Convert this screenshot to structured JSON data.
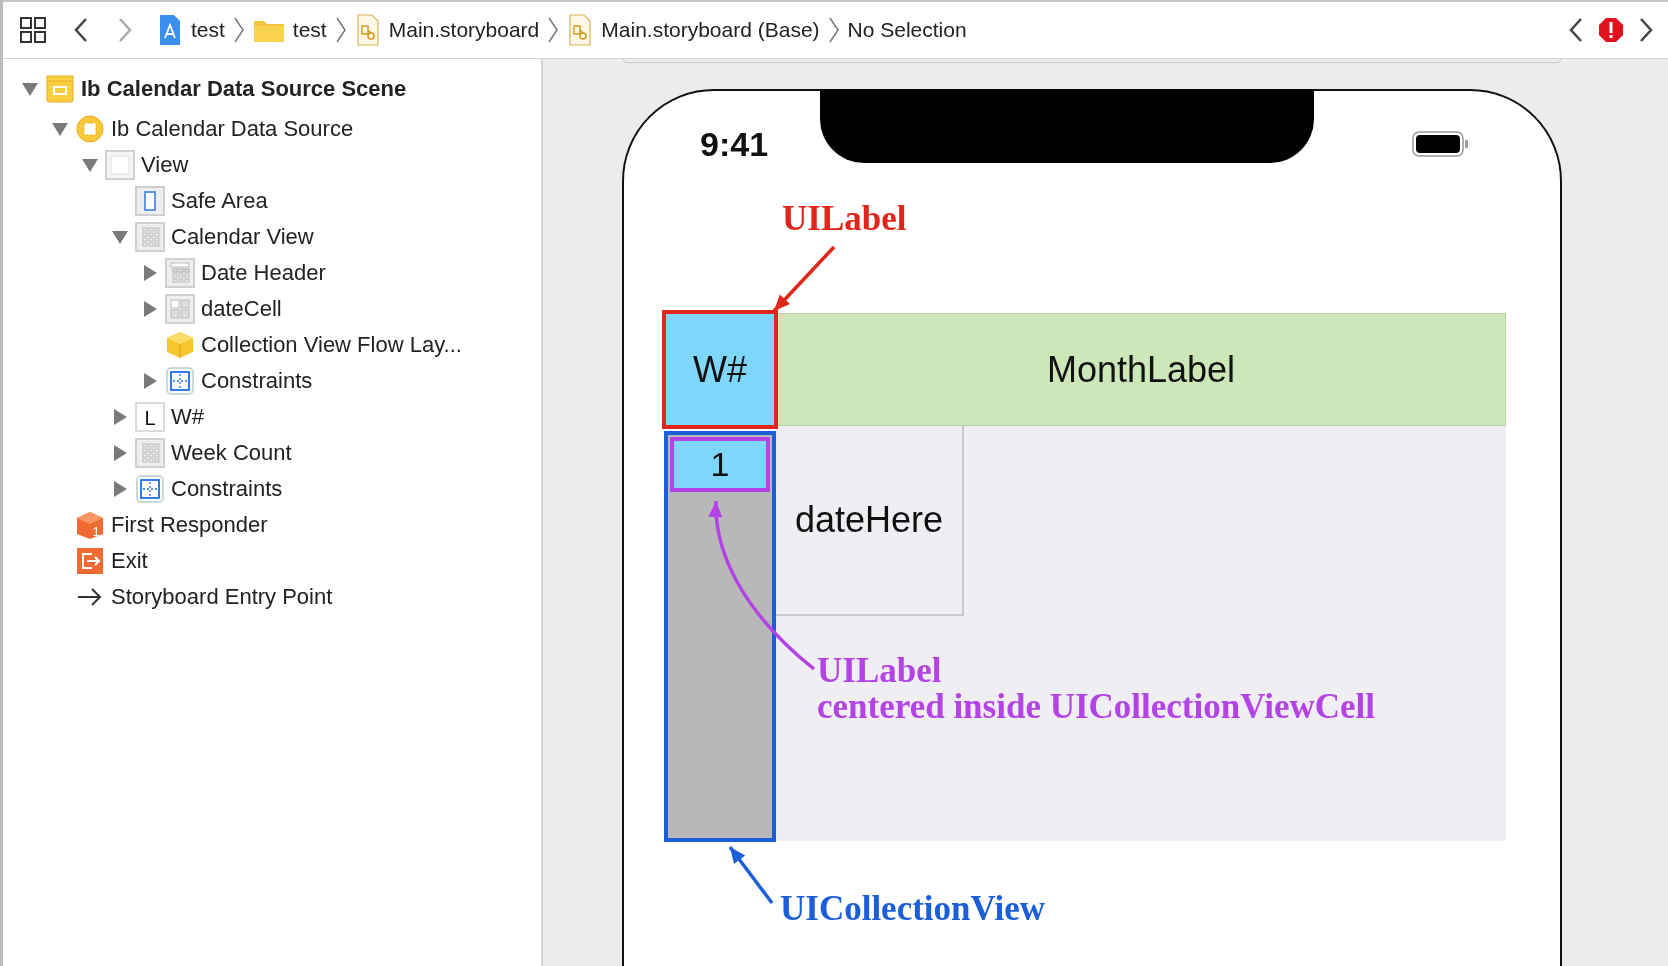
{
  "toolbar": {
    "breadcrumbs": [
      {
        "label": "test",
        "kind": "project"
      },
      {
        "label": "test",
        "kind": "folder"
      },
      {
        "label": "Main.storyboard",
        "kind": "storyboard"
      },
      {
        "label": "Main.storyboard (Base)",
        "kind": "storyboard"
      },
      {
        "label": "No Selection",
        "kind": "plain"
      }
    ]
  },
  "outline": {
    "items": [
      {
        "label": "Ib Calendar Data Source Scene",
        "kind": "scene",
        "expanded": true,
        "children": [
          {
            "label": "Ib Calendar Data Source",
            "kind": "controller",
            "expanded": true,
            "children": [
              {
                "label": "View",
                "kind": "view",
                "expanded": true,
                "children": [
                  {
                    "label": "Safe Area",
                    "kind": "safe-area"
                  },
                  {
                    "label": "Calendar View",
                    "kind": "grid",
                    "expanded": true,
                    "children": [
                      {
                        "label": "Date Header",
                        "kind": "header",
                        "expanded": false
                      },
                      {
                        "label": "dateCell",
                        "kind": "cell",
                        "expanded": false
                      },
                      {
                        "label": "Collection View Flow Lay...",
                        "kind": "cube"
                      },
                      {
                        "label": "Constraints",
                        "kind": "constraints",
                        "expanded": false
                      }
                    ]
                  },
                  {
                    "label": "W#",
                    "kind": "label",
                    "icon_letter": "L",
                    "expanded": false
                  },
                  {
                    "label": "Week Count",
                    "kind": "grid",
                    "expanded": false
                  },
                  {
                    "label": "Constraints",
                    "kind": "constraints",
                    "expanded": false
                  }
                ]
              }
            ]
          },
          {
            "label": "First Responder",
            "kind": "responder",
            "icon_letter": "1"
          },
          {
            "label": "Exit",
            "kind": "exit"
          },
          {
            "label": "Storyboard Entry Point",
            "kind": "entry"
          }
        ]
      }
    ]
  },
  "canvas": {
    "status_time": "9:41",
    "week_label": "W#",
    "month_label": "MonthLabel",
    "week_cell": "1",
    "date_cell": "dateHere",
    "annotations": [
      {
        "kind": "week-label",
        "lines": [
          "UILabel"
        ],
        "color": "#e0261b"
      },
      {
        "kind": "cell-label",
        "lines": [
          "UILabel",
          "centered inside UICollectionViewCell"
        ],
        "color": "#b443e6"
      },
      {
        "kind": "collection",
        "lines": [
          "UICollectionView"
        ],
        "color": "#1b5fd8"
      }
    ]
  }
}
